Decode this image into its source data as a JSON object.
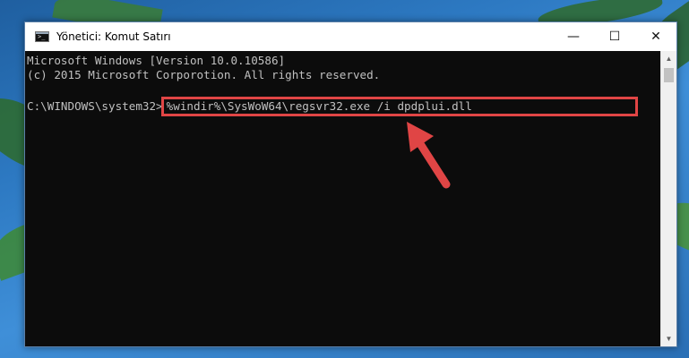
{
  "window": {
    "title": "Yönetici: Komut Satırı",
    "controls": {
      "minimize": "—",
      "maximize": "☐",
      "close": "✕"
    }
  },
  "console": {
    "lines": [
      "Microsoft Windows [Version 10.0.10586]",
      "(c) 2015 Microsoft Corporotion. All rights reserved."
    ],
    "prompt": "C:\\WINDOWS\\system32>",
    "command": "%windir%\\SysWoW64\\regsvr32.exe /i dpdplui.dll"
  },
  "colors": {
    "highlight_box": "#e04545",
    "arrow": "#e04545",
    "console_bg": "#0c0c0c",
    "console_text": "#c0c0c0"
  },
  "icons": {
    "app": "command-prompt-icon",
    "scroll_up": "scroll-up-arrow-icon",
    "scroll_down": "scroll-down-arrow-icon",
    "annotation": "red-arrow-icon"
  }
}
